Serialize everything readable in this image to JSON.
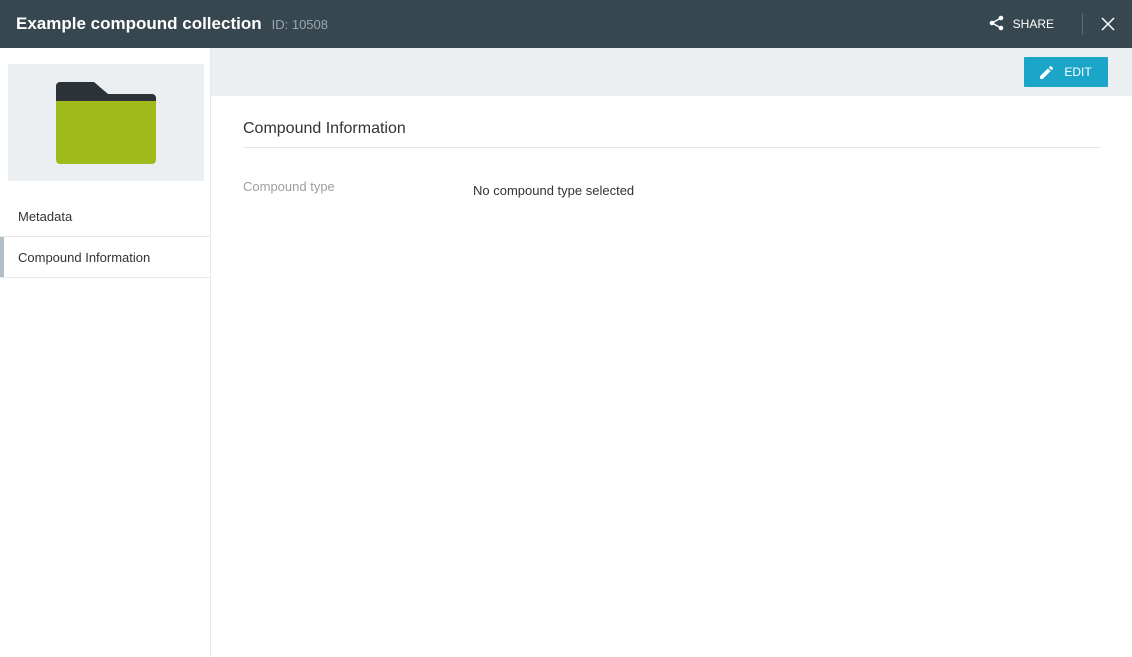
{
  "header": {
    "title": "Example compound collection",
    "id_label": "ID: 10508",
    "share_label": "SHARE",
    "background_color": "#37474f"
  },
  "thumbnail": {
    "icon": "folder-icon",
    "folder_color": "#a0ba1c",
    "tab_color": "#2b3238"
  },
  "sidebar": {
    "items": [
      {
        "label": "Metadata",
        "active": false
      },
      {
        "label": "Compound Information",
        "active": true
      }
    ]
  },
  "toolbar": {
    "edit_label": "EDIT",
    "edit_color": "#1ba5c9"
  },
  "main": {
    "section_title": "Compound Information",
    "fields": [
      {
        "label": "Compound type",
        "value": "No compound type selected"
      }
    ]
  }
}
